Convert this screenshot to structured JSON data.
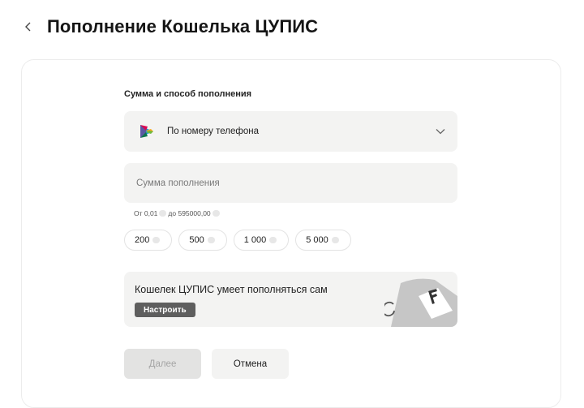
{
  "header": {
    "title": "Пополнение Кошелька ЦУПИС"
  },
  "form": {
    "section_label": "Сумма и способ пополнения",
    "method": {
      "selected": "По номеру телефона"
    },
    "amount": {
      "placeholder": "Сумма пополнения",
      "value": ""
    },
    "range_from": "От 0,01",
    "range_to": "до 595000,00",
    "presets": [
      "200",
      "500",
      "1 000",
      "5 000"
    ]
  },
  "promo": {
    "text": "Кошелек ЦУПИС умеет пополняться сам",
    "button": "Настроить",
    "art_letter": "F"
  },
  "actions": {
    "next": "Далее",
    "cancel": "Отмена"
  },
  "colors": {
    "field_bg": "#f3f3f2",
    "setup_button": "#5e5e5e",
    "disabled_button": "#e3e3e2"
  }
}
